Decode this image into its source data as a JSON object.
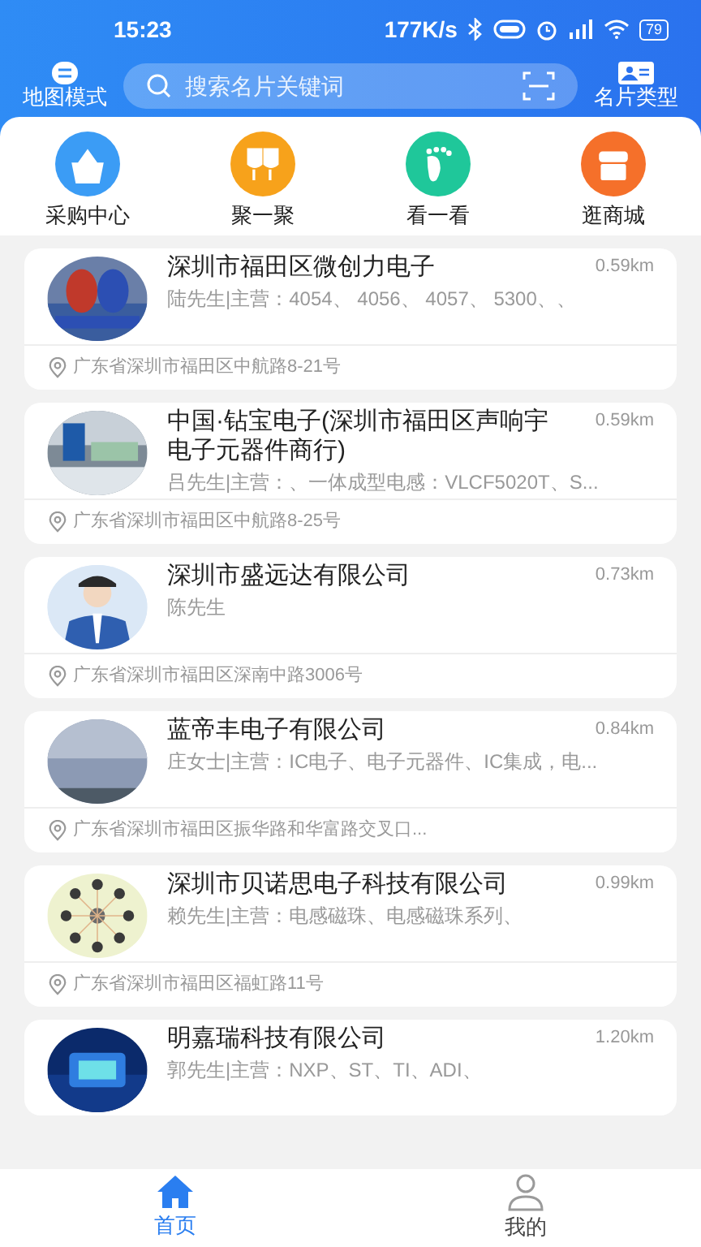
{
  "status_bar": {
    "time": "15:23",
    "speed": "177K/s",
    "battery": "79"
  },
  "header": {
    "map_mode": "地图模式",
    "search": {
      "placeholder": "搜索名片关键词"
    },
    "card_type": "名片类型"
  },
  "shortcuts": [
    {
      "kind": "basket",
      "label": "采购中心",
      "color": "#3b9cf5"
    },
    {
      "kind": "glasses",
      "label": "聚一聚",
      "color": "#f7a21b"
    },
    {
      "kind": "foot",
      "label": "看一看",
      "color": "#1fc79a"
    },
    {
      "kind": "shop",
      "label": "逛商城",
      "color": "#f5702a"
    }
  ],
  "cards": [
    {
      "name": "深圳市福田区微创力电子",
      "distance": "0.59km",
      "subtitle": "陆先生|主营：4054、 4056、 4057、 5300、、",
      "address": "广东省深圳市福田区中航路8-21号"
    },
    {
      "name": "中国·钻宝电子(深圳市福田区声响宇电子元器件商行)",
      "distance": "0.59km",
      "subtitle": "吕先生|主营：、一体成型电感：VLCF5020T、S...",
      "address": "广东省深圳市福田区中航路8-25号"
    },
    {
      "name": "深圳市盛远达有限公司",
      "distance": "0.73km",
      "subtitle": "陈先生",
      "address": "广东省深圳市福田区深南中路3006号"
    },
    {
      "name": "蓝帝丰电子有限公司",
      "distance": "0.84km",
      "subtitle": "庄女士|主营：IC电子、电子元器件、IC集成，电...",
      "address": "广东省深圳市福田区振华路和华富路交叉口..."
    },
    {
      "name": "深圳市贝诺思电子科技有限公司",
      "distance": "0.99km",
      "subtitle": "赖先生|主营：电感磁珠、电感磁珠系列、",
      "address": "广东省深圳市福田区福虹路11号"
    },
    {
      "name": "明嘉瑞科技有限公司",
      "distance": "1.20km",
      "subtitle": "郭先生|主营：NXP、ST、TI、ADI、"
    }
  ],
  "bottom_nav": [
    {
      "kind": "home",
      "label": "首页",
      "selected": true
    },
    {
      "kind": "user",
      "label": "我的",
      "selected": false
    }
  ]
}
